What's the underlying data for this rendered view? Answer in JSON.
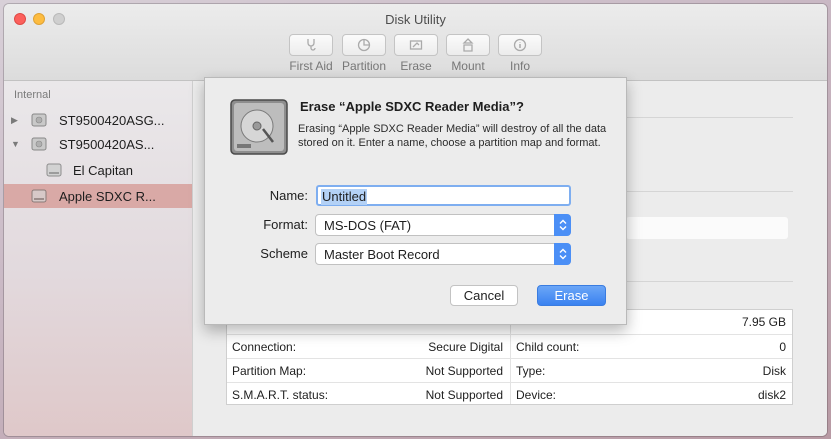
{
  "window": {
    "title": "Disk Utility"
  },
  "toolbar": {
    "buttons": [
      {
        "label": "First Aid",
        "icon": "stethoscope-icon"
      },
      {
        "label": "Partition",
        "icon": "pie-icon"
      },
      {
        "label": "Erase",
        "icon": "erase-icon"
      },
      {
        "label": "Mount",
        "icon": "mount-icon"
      },
      {
        "label": "Info",
        "icon": "info-icon"
      }
    ]
  },
  "sidebar": {
    "section": "Internal",
    "items": [
      {
        "label": "ST9500420ASG...",
        "disclosure": "▶"
      },
      {
        "label": "ST9500420AS...",
        "disclosure": "▼"
      },
      {
        "label": "El Capitan"
      },
      {
        "label": "Apple SDXC R...",
        "selected": true
      }
    ]
  },
  "info": {
    "top_right_value": "7.95 GB",
    "left": [
      {
        "label": "Connection:",
        "value": "Secure Digital"
      },
      {
        "label": "Partition Map:",
        "value": "Not Supported"
      },
      {
        "label": "S.M.A.R.T. status:",
        "value": "Not Supported"
      }
    ],
    "right": [
      {
        "label": "Child count:",
        "value": "0"
      },
      {
        "label": "Type:",
        "value": "Disk"
      },
      {
        "label": "Device:",
        "value": "disk2"
      }
    ]
  },
  "dialog": {
    "title": "Erase “Apple SDXC Reader Media”?",
    "message": "Erasing “Apple SDXC Reader Media” will destroy of all the data stored on it. Enter a name, choose a partition map and format.",
    "name_label": "Name:",
    "name_value": "Untitled",
    "format_label": "Format:",
    "format_value": "MS-DOS (FAT)",
    "scheme_label": "Scheme",
    "scheme_value": "Master Boot Record",
    "cancel_label": "Cancel",
    "erase_label": "Erase"
  },
  "colors": {
    "accent": "#3a82f0",
    "selection": "#d9a9a6"
  }
}
